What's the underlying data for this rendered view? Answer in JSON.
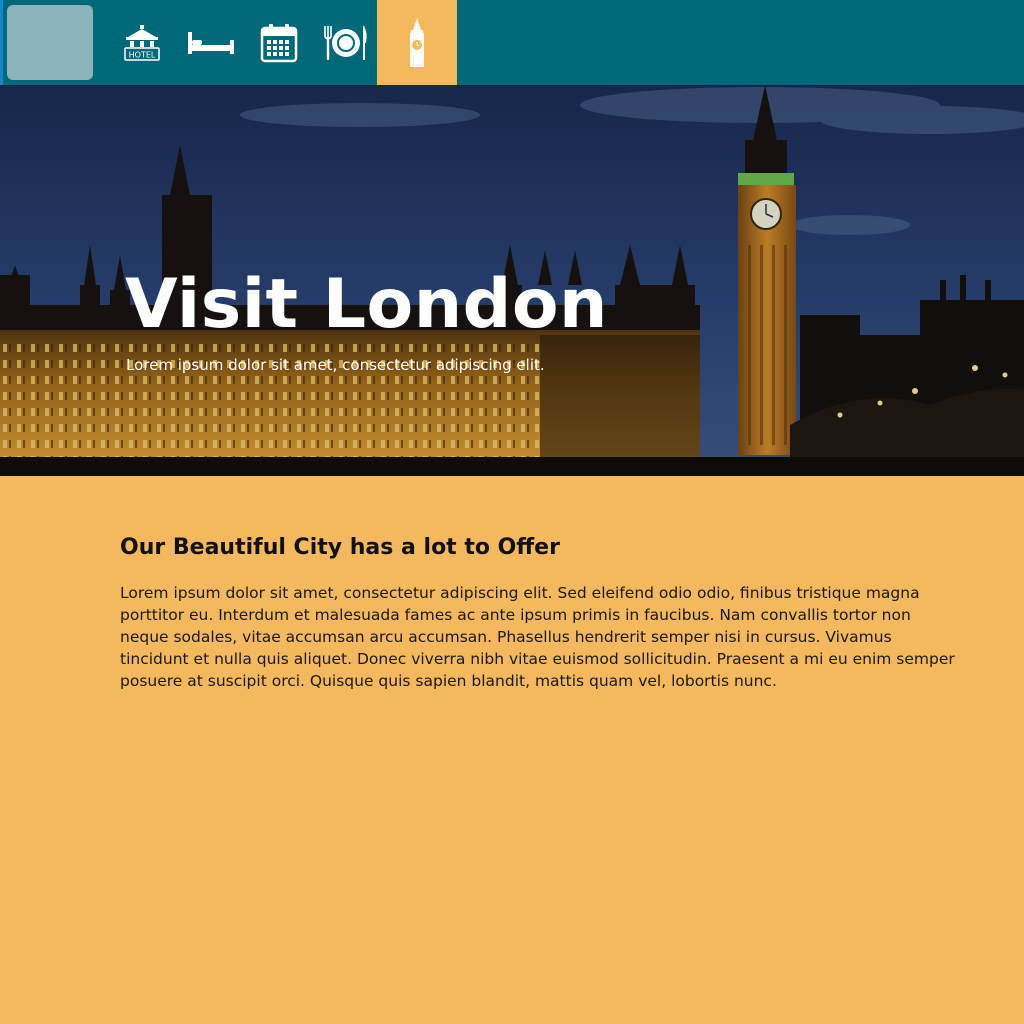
{
  "nav": {
    "items": [
      {
        "name": "hotel",
        "icon": "hotel-sign-icon",
        "label": "HOTEL"
      },
      {
        "name": "bed",
        "icon": "bed-icon"
      },
      {
        "name": "calendar",
        "icon": "calendar-icon"
      },
      {
        "name": "dining",
        "icon": "plate-cutlery-icon"
      },
      {
        "name": "landmark",
        "icon": "big-ben-icon",
        "active": true
      }
    ]
  },
  "hero": {
    "title": "Visit London",
    "subtitle": "Lorem ipsum dolor sit amet, consectetur adipiscing elit."
  },
  "content": {
    "heading": "Our Beautiful City has a lot to Offer",
    "body": "Lorem ipsum dolor sit amet, consectetur adipiscing elit. Sed eleifend odio odio, finibus tristique magna porttitor eu. Interdum et malesuada fames ac ante ipsum primis in faucibus. Nam convallis tortor non neque sodales, vitae accumsan arcu accumsan. Phasellus hendrerit semper nisi in cursus. Vivamus tincidunt et nulla quis aliquet. Donec viverra nibh vitae euismod sollicitudin. Praesent a mi eu enim semper posuere at suscipit orci. Quisque quis sapien blandit, mattis quam vel, lobortis nunc."
  },
  "colors": {
    "topbar": "#01687a",
    "accent": "#f4b85d",
    "logo_box": "#8bb3bc"
  }
}
